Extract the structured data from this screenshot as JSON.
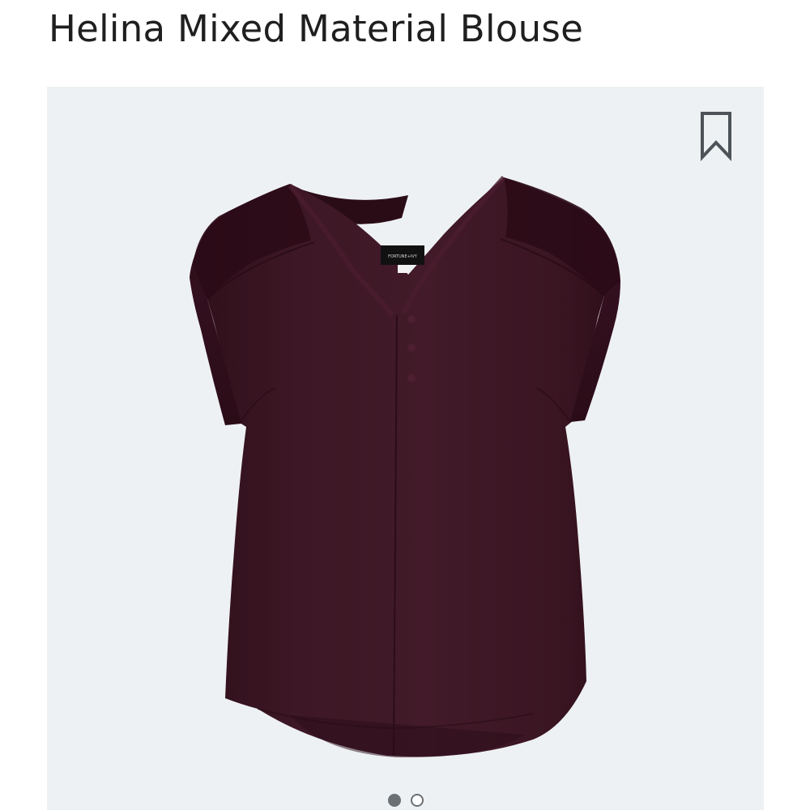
{
  "product": {
    "title": "Helina Mixed Material Blouse",
    "brand_label": "FORTUNE+IVY",
    "garment_color": "#3c1624"
  },
  "gallery": {
    "bookmark_icon": "bookmark-icon",
    "background": "#eef1f3",
    "image_count": 2,
    "active_index": 1
  }
}
